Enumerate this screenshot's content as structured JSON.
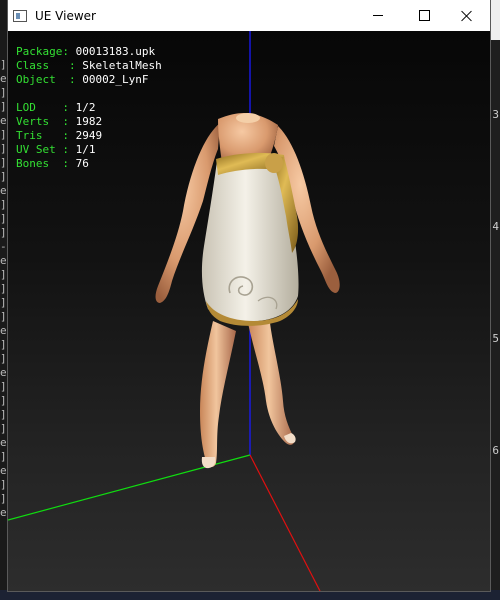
{
  "window": {
    "title": "UE Viewer"
  },
  "titlebar_controls": {
    "minimize_icon": "minimize-icon",
    "maximize_icon": "maximize-icon",
    "close_icon": "close-icon"
  },
  "info_overlay": {
    "package": {
      "label": "Package: ",
      "value": "00013183.upk"
    },
    "class": {
      "label": "Class   : ",
      "value": "SkeletalMesh"
    },
    "object": {
      "label": "Object  : ",
      "value": "00002_LynF"
    },
    "lod": {
      "label": "LOD    : ",
      "value": "1/2"
    },
    "verts": {
      "label": "Verts  : ",
      "value": "1982"
    },
    "tris": {
      "label": "Tris   : ",
      "value": "2949"
    },
    "uvset": {
      "label": "UV Set : ",
      "value": "1/1"
    },
    "bones": {
      "label": "Bones  : ",
      "value": "76"
    }
  },
  "background_right_numbers": [
    "3",
    "4",
    "5",
    "6"
  ],
  "axis_colors": {
    "x": "#e01010",
    "y": "#10dd10",
    "z": "#1a1aff"
  },
  "colors": {
    "viewport_bg": "#0a0a0a",
    "overlay_label": "#33e033",
    "overlay_value": "#ffffff",
    "skin": "#e2a77f",
    "dress": "#e8e4d8",
    "sash": "#b8902e"
  }
}
